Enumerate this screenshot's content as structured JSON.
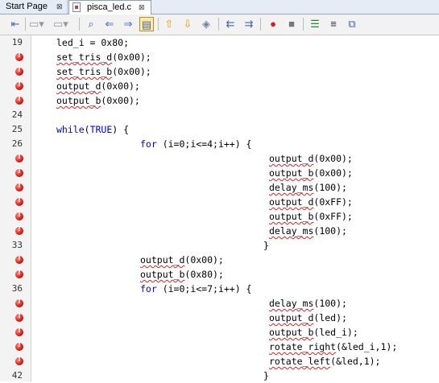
{
  "tabs": [
    {
      "label": "Start Page",
      "close": "⊠"
    },
    {
      "label": "pisca_led.c",
      "close": "⊠"
    }
  ],
  "gutter": [
    "19",
    "",
    "",
    "",
    "",
    "24",
    "25",
    "26",
    "",
    "",
    "",
    "",
    "",
    "",
    "33",
    "",
    "",
    "36",
    "",
    "",
    "",
    "",
    "",
    "42"
  ],
  "errors": [
    false,
    true,
    true,
    true,
    true,
    false,
    false,
    false,
    true,
    true,
    true,
    true,
    true,
    true,
    false,
    true,
    true,
    false,
    true,
    true,
    true,
    true,
    true,
    false
  ],
  "code": {
    "l0": {
      "text": "led_i = 0x80;"
    },
    "l1": {
      "fn": "set_tris_d",
      "args": "(0x00);"
    },
    "l2": {
      "fn": "set_tris_b",
      "args": "(0x00);"
    },
    "l3": {
      "fn": "output_d",
      "args": "(0x00);"
    },
    "l4": {
      "fn": "output_b",
      "args": "(0x00);"
    },
    "l6": {
      "kw1": "while",
      "p1": "(",
      "kw2": "TRUE",
      "p2": ") {"
    },
    "l7": {
      "kw": "for",
      "rest": " (i=0;i<=4;i++) {"
    },
    "l8": {
      "fn": "output_d",
      "args": "(0x00);"
    },
    "l9": {
      "fn": "output_b",
      "args": "(0x00);"
    },
    "l10": {
      "fn": "delay_ms",
      "args": "(100);"
    },
    "l11": {
      "fn": "output_d",
      "args": "(0xFF);"
    },
    "l12": {
      "fn": "output_b",
      "args": "(0xFF);"
    },
    "l13": {
      "fn": "delay_ms",
      "args": "(100);"
    },
    "l14": {
      "text": "}"
    },
    "l15": {
      "fn": "output_d",
      "args": "(0x00);"
    },
    "l16": {
      "fn": "output_b",
      "args": "(0x80);"
    },
    "l17": {
      "kw": "for",
      "rest": " (i=0;i<=7;i++) {"
    },
    "l18": {
      "fn": "delay_ms",
      "args": "(100);"
    },
    "l19": {
      "fn": "output_d",
      "args": "(led);"
    },
    "l20": {
      "fn": "output_b",
      "args": "(led_i);"
    },
    "l21": {
      "fn": "rotate_right",
      "args": "(&led_i,1);"
    },
    "l22": {
      "fn": "rotate_left",
      "args": "(&led,1);"
    },
    "l23": {
      "text": "}"
    }
  },
  "toolbar_icons": [
    "last-edit-icon",
    "back-icon",
    "forward-icon",
    "find-selection-icon",
    "find-previous-icon",
    "find-next-icon",
    "toggle-highlight-icon",
    "previous-bookmark-icon",
    "next-bookmark-icon",
    "toggle-bookmark-icon",
    "shift-left-icon",
    "shift-right-icon",
    "start-macro-icon",
    "stop-macro-icon",
    "comment-icon",
    "uncomment-icon",
    "diff-icon"
  ]
}
